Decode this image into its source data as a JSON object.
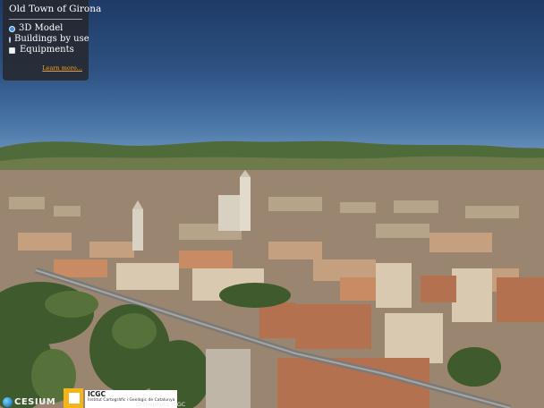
{
  "panel": {
    "title": "Old Town of Girona",
    "options": [
      {
        "label": "3D Model",
        "selected": true
      },
      {
        "label": "Buildings by use",
        "selected": false
      }
    ],
    "equipments_label": "Equipments",
    "learn_more": "Learn more..."
  },
  "credits": {
    "cesium": "CESIUM",
    "icgc_name": "ICGC",
    "icgc_subtitle": "Institut Cartogràfic i Geològic de Catalunya",
    "orthophoto": "Orthophoto ICGC"
  },
  "colors": {
    "panel_bg": "#26262a",
    "accent_radio": "#3d8ee6",
    "link": "#f0a430",
    "icgc_brand": "#f3b51a"
  }
}
